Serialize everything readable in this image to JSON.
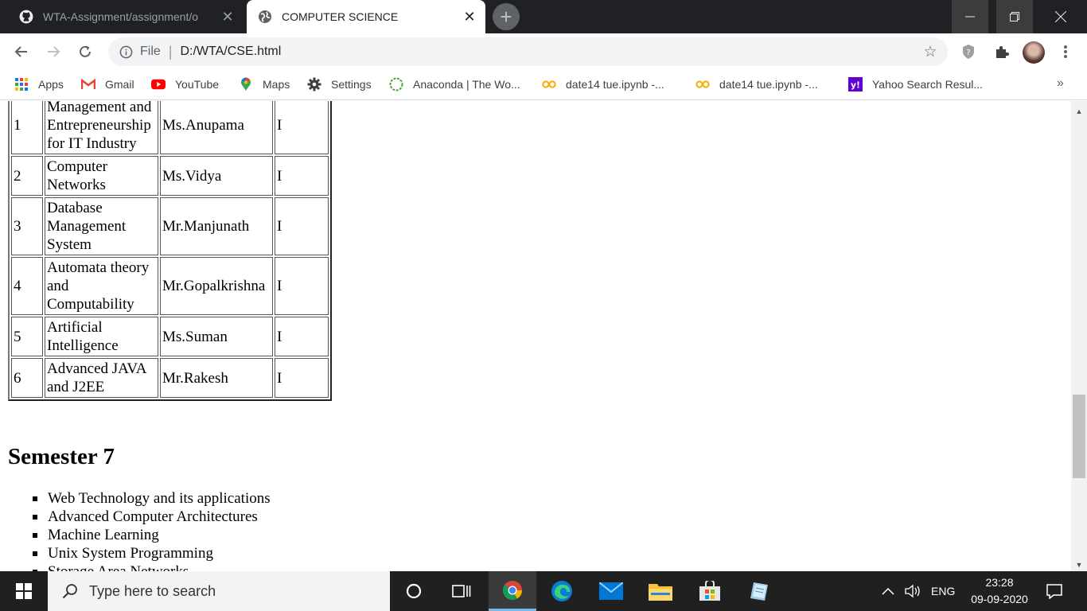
{
  "browser": {
    "tabs": [
      {
        "title": "WTA-Assignment/assignment/o",
        "icon": "github-icon",
        "active": false
      },
      {
        "title": "COMPUTER SCIENCE",
        "icon": "globe-icon",
        "active": true
      }
    ],
    "address": {
      "scheme": "File",
      "url": "D:/WTA/CSE.html"
    },
    "bookmarks": [
      {
        "label": "Apps",
        "icon": "apps-grid-icon"
      },
      {
        "label": "Gmail",
        "icon": "gmail-icon"
      },
      {
        "label": "YouTube",
        "icon": "youtube-icon"
      },
      {
        "label": "Maps",
        "icon": "maps-pin-icon"
      },
      {
        "label": "Settings",
        "icon": "gear-icon"
      },
      {
        "label": "Anaconda | The Wo...",
        "icon": "anaconda-icon"
      },
      {
        "label": "date14 tue.ipynb -...",
        "icon": "colab-icon"
      },
      {
        "label": "date14 tue.ipynb -...",
        "icon": "colab-icon"
      },
      {
        "label": "Yahoo Search Resul...",
        "icon": "yahoo-icon"
      }
    ],
    "bookmarks_more": "»"
  },
  "page": {
    "table_rows": [
      {
        "no": "1",
        "subject": "Management and Entrepreneurship for IT Industry",
        "faculty": "Ms.Anupama",
        "section": "I"
      },
      {
        "no": "2",
        "subject": "Computer Networks",
        "faculty": "Ms.Vidya",
        "section": "I"
      },
      {
        "no": "3",
        "subject": "Database Management System",
        "faculty": "Mr.Manjunath",
        "section": "I"
      },
      {
        "no": "4",
        "subject": "Automata theory and Computability",
        "faculty": "Mr.Gopalkrishna",
        "section": "I"
      },
      {
        "no": "5",
        "subject": "Artificial Intelligence",
        "faculty": "Ms.Suman",
        "section": "I"
      },
      {
        "no": "6",
        "subject": "Advanced JAVA and J2EE",
        "faculty": "Mr.Rakesh",
        "section": "I"
      }
    ],
    "semester_heading": "Semester 7",
    "courses": [
      "Web Technology and its applications",
      "Advanced Computer Architectures",
      "Machine Learning",
      "Unix System Programming",
      "Storage Area Networks"
    ]
  },
  "taskbar": {
    "search_placeholder": "Type here to search",
    "language": "ENG",
    "time": "23:28",
    "date": "09-09-2020"
  }
}
